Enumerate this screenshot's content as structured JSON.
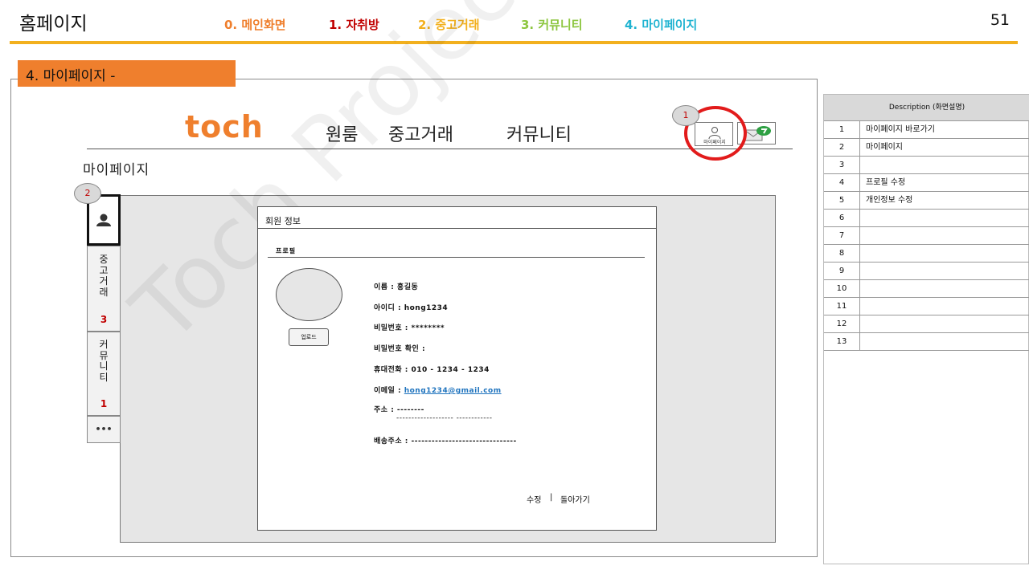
{
  "header": {
    "page_title": "홈페이지",
    "slide_number": "51",
    "nav": [
      {
        "label": "0. 메인화면",
        "color": "#ef7f2d"
      },
      {
        "label": "1. 자취방",
        "color": "#c00000"
      },
      {
        "label": "2. 중고거래",
        "color": "#f2b01e"
      },
      {
        "label": "3. 커뮤니티",
        "color": "#8dc63f"
      },
      {
        "label": "4. 마이페이지",
        "color": "#1fb3d1"
      }
    ],
    "accent": "#f2b01e"
  },
  "section_tag": "4. 마이페이지 -",
  "site": {
    "logo": "toch",
    "nav": [
      "원룸",
      "중고거래",
      "커뮤니티"
    ],
    "profile_button_label": "마이페이지",
    "mail_icon": "mail-icon",
    "user_icon": "user-icon"
  },
  "badges": [
    "1",
    "2"
  ],
  "mypage_heading": "마이페이지",
  "side_tabs": {
    "market_label": "중고거래",
    "market_count": "3",
    "community_label": "커뮤니티",
    "community_count": "1",
    "more_label": "•••"
  },
  "member_card": {
    "title": "회원 정보",
    "subtitle": "프로필",
    "upload_label": "업로드",
    "fields": {
      "name": "이름 : 홍길동",
      "id": "아이디 : hong1234",
      "password": "비밀번호 : ********",
      "password_confirm": "비밀번호 확인 :",
      "phone": "휴대전화 : 010 - 1234 - 1234",
      "email_label": "이메일 : ",
      "email_value": "hong1234@gmail.com",
      "address_line1": "주소 : --------",
      "address_line2": "-------------------    ------------",
      "shipping_address": "배송주소 : -------------------------------"
    },
    "edit_link": "수정",
    "separator": "|",
    "back_link": "돌아가기"
  },
  "watermark": "Toch Project.",
  "description": {
    "header": "Description (화면설명)",
    "rows": [
      {
        "num": "1",
        "text": "마이페이지 바로가기"
      },
      {
        "num": "2",
        "text": "마이페이지"
      },
      {
        "num": "3",
        "text": ""
      },
      {
        "num": "4",
        "text": "프로필 수정"
      },
      {
        "num": "5",
        "text": "개인정보 수정"
      },
      {
        "num": "6",
        "text": ""
      },
      {
        "num": "7",
        "text": ""
      },
      {
        "num": "8",
        "text": ""
      },
      {
        "num": "9",
        "text": ""
      },
      {
        "num": "10",
        "text": ""
      },
      {
        "num": "11",
        "text": ""
      },
      {
        "num": "12",
        "text": ""
      },
      {
        "num": "13",
        "text": ""
      }
    ]
  }
}
